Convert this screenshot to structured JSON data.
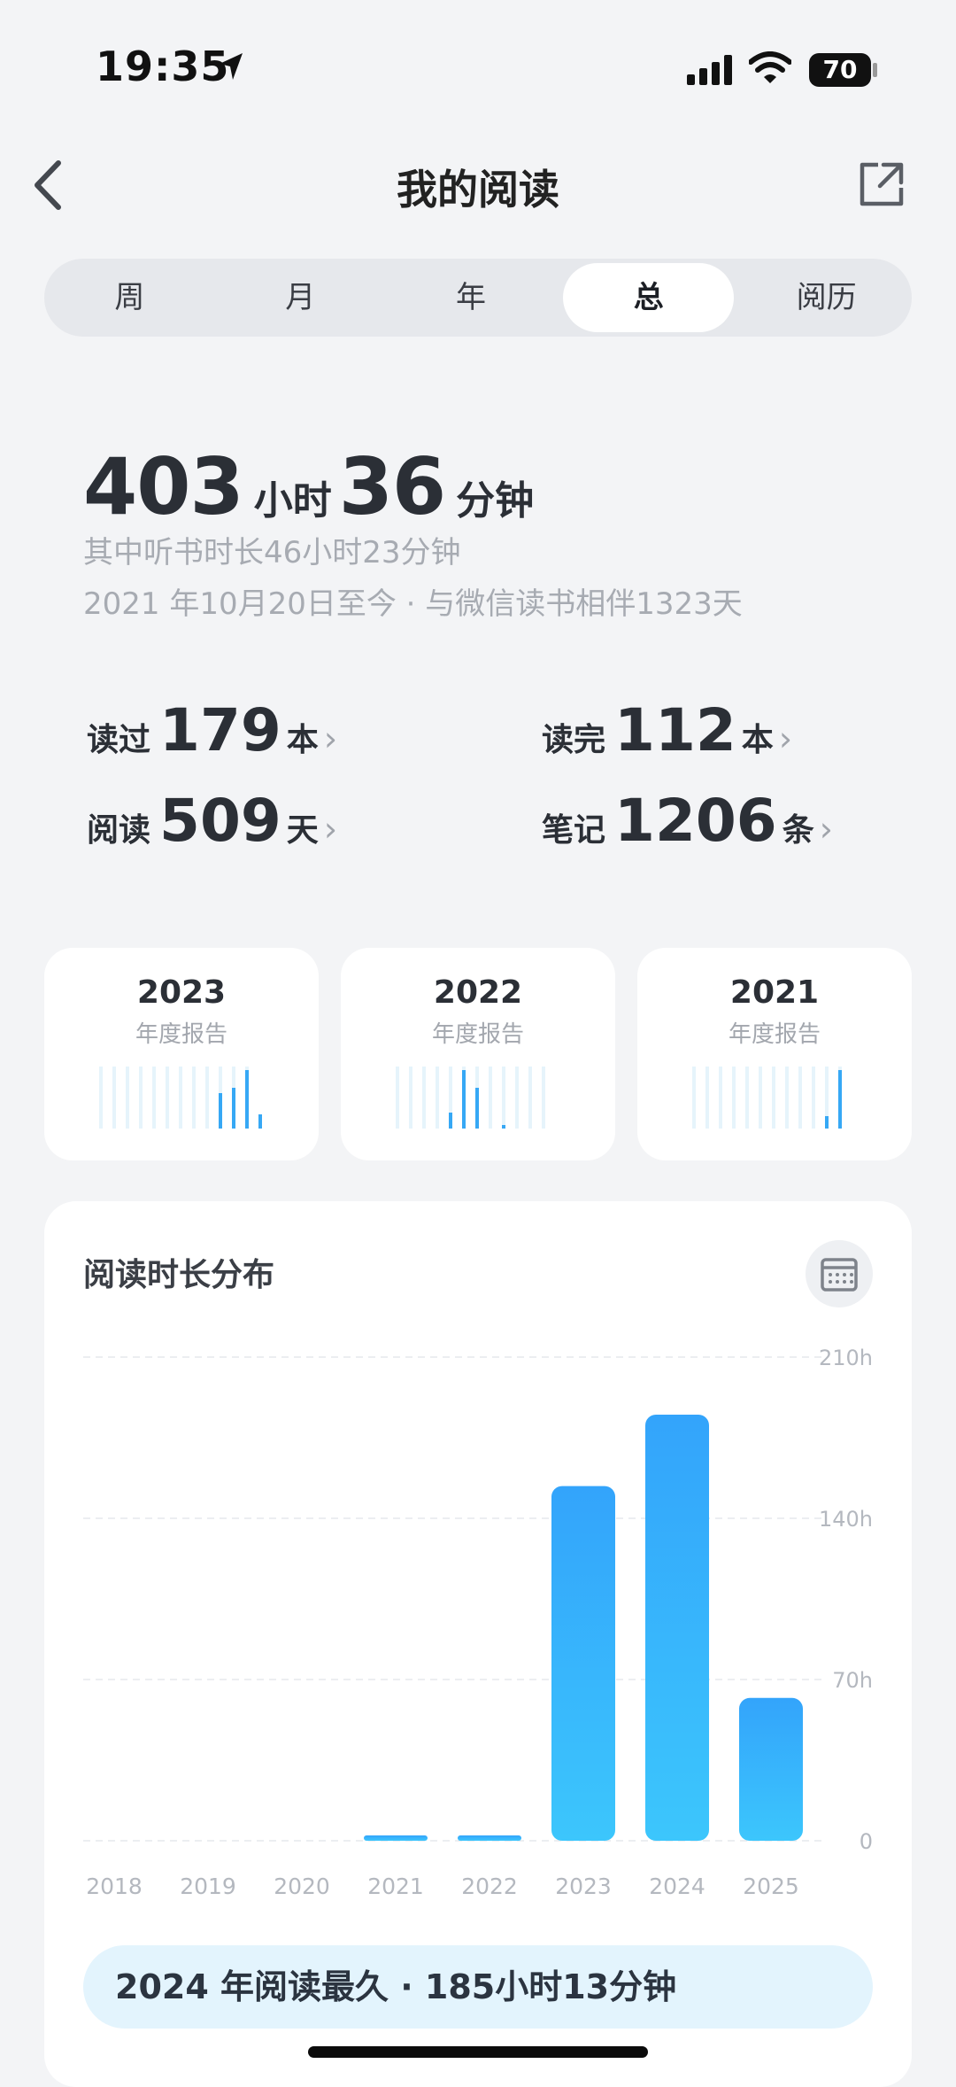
{
  "status_bar": {
    "time": "19:35",
    "battery": "70"
  },
  "nav": {
    "title": "我的阅读",
    "back_icon": "chevron-left-icon",
    "share_icon": "share-icon"
  },
  "tabs": [
    {
      "label": "周",
      "active": false
    },
    {
      "label": "月",
      "active": false
    },
    {
      "label": "年",
      "active": false
    },
    {
      "label": "总",
      "active": true
    },
    {
      "label": "阅历",
      "active": false
    }
  ],
  "total": {
    "hours": "403",
    "hours_unit": "小时",
    "minutes": "36",
    "minutes_unit": "分钟",
    "listen_line": "其中听书时长46小时23分钟",
    "since_line": "2021 年10月20日至今 · 与微信读书相伴1323天"
  },
  "stats": {
    "read": {
      "label": "读过",
      "value": "179",
      "unit": "本"
    },
    "finished": {
      "label": "读完",
      "value": "112",
      "unit": "本"
    },
    "days": {
      "label": "阅读",
      "value": "509",
      "unit": "天"
    },
    "notes": {
      "label": "笔记",
      "value": "1206",
      "unit": "条"
    },
    "chevron": "›"
  },
  "year_reports": [
    {
      "year": "2023",
      "label": "年度报告"
    },
    {
      "year": "2022",
      "label": "年度报告"
    },
    {
      "year": "2021",
      "label": "年度报告"
    }
  ],
  "distribution": {
    "title": "阅读时长分布",
    "calendar_icon": "calendar-icon",
    "summary": "2024 年阅读最久 · 185小时13分钟"
  },
  "chart_data": {
    "type": "bar",
    "title": "阅读时长分布",
    "categories": [
      "2018",
      "2019",
      "2020",
      "2021",
      "2022",
      "2023",
      "2024",
      "2025"
    ],
    "values": [
      0,
      0,
      0,
      1,
      1,
      154,
      185,
      62
    ],
    "y_ticks": [
      "0",
      "70h",
      "140h",
      "210h"
    ],
    "ylim": [
      0,
      210
    ],
    "grid": true,
    "bar_color": "#35b6fb",
    "axis_color": "#b4b8bf"
  },
  "colors": {
    "bar_top": "#33a4fb",
    "bar_bottom": "#3cc6fc",
    "mini_bar": "#36a8f5",
    "mini_bg": "#e6f4fb"
  }
}
